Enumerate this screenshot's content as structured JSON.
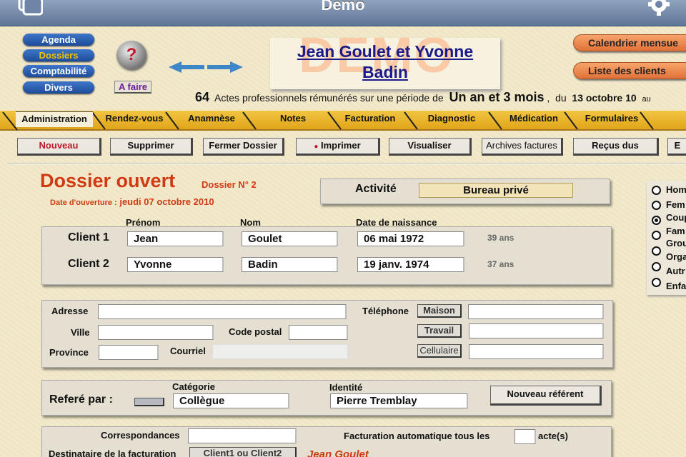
{
  "app": {
    "title": "Demo"
  },
  "nav": {
    "items": [
      "Agenda",
      "Dossiers",
      "Comptabilité",
      "Divers"
    ],
    "selected": "Dossiers"
  },
  "help": {
    "symbol": "?"
  },
  "afaire_label": "A faire",
  "client_name": {
    "line1": "Jean Goulet et Yvonne",
    "line2": "Badin",
    "watermark": "DEMO"
  },
  "right_buttons": {
    "calendar": "Calendrier mensue",
    "clients": "Liste des clients"
  },
  "stats": {
    "count": "64",
    "text1": "Actes professionnels rémunérés sur une période de",
    "period": "Un an et 3 mois",
    "sep": ",",
    "du": "du",
    "date": "13 octobre 10",
    "au": "au"
  },
  "tabs": [
    "Administration",
    "Rendez-vous",
    "Anamnèse",
    "Notes",
    "Facturation",
    "Diagnostic",
    "Médication",
    "Formulaires"
  ],
  "toolbar": {
    "nouveau": "Nouveau",
    "supprimer": "Supprimer",
    "fermer": "Fermer Dossier",
    "imprimer": "Imprimer",
    "visualiser": "Visualiser",
    "archives": "Archives factures",
    "recus": "Reçus dus",
    "more": "E"
  },
  "dossier": {
    "title": "Dossier ouvert",
    "number": "Dossier N° 2",
    "opened_label": "Date d'ouverture :",
    "opened_date": "jeudi 07 octobre 2010"
  },
  "activite": {
    "label": "Activité",
    "value": "Bureau privé"
  },
  "clients": {
    "headers": {
      "prenom": "Prénom",
      "nom": "Nom",
      "naissance": "Date de naissance"
    },
    "rows": [
      {
        "label": "Client 1",
        "prenom": "Jean",
        "nom": "Goulet",
        "naissance": "06 mai 1972",
        "age": "39 ans"
      },
      {
        "label": "Client 2",
        "prenom": "Yvonne",
        "nom": "Badin",
        "naissance": "19 janv. 1974",
        "age": "37 ans"
      }
    ]
  },
  "type_options": [
    "Hom",
    "Fem",
    "Coup",
    "Fam",
    "Grou",
    "Orga",
    "Autr",
    "Enfa"
  ],
  "type_selected": "Coup",
  "address": {
    "adresse": "Adresse",
    "ville": "Ville",
    "code_postal": "Code postal",
    "province": "Province",
    "courriel": "Courriel",
    "telephone": "Téléphone",
    "maison": "Maison",
    "travail": "Travail",
    "cellulaire": "Cellulaire"
  },
  "referral": {
    "label": "Referé par :",
    "categorie_label": "Catégorie",
    "categorie": "Collègue",
    "identite_label": "Identité",
    "identite": "Pierre Tremblay",
    "new_btn": "Nouveau référent"
  },
  "billing": {
    "correspondances": "Correspondances",
    "auto": "Facturation  automatique tous les",
    "actes": "acte(s)",
    "destinataire": "Destinataire de la facturation",
    "dest_btn": "Client1 ou Client2",
    "dest_name": "Jean Goulet"
  },
  "colors": {
    "accent_red": "#d03a12",
    "tab_yellow": "#f1c540",
    "nav_blue": "#1d4b9a"
  }
}
